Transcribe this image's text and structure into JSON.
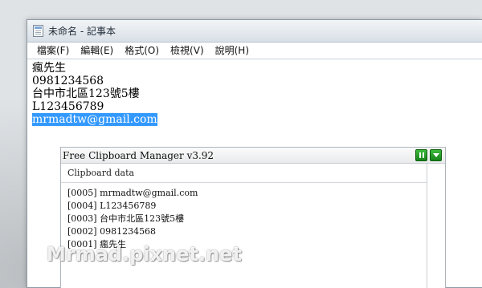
{
  "window": {
    "title": "未命名 - 記事本"
  },
  "menu": {
    "items": [
      {
        "label": "檔案(F)"
      },
      {
        "label": "編輯(E)"
      },
      {
        "label": "格式(O)"
      },
      {
        "label": "檢視(V)"
      },
      {
        "label": "說明(H)"
      }
    ]
  },
  "editor": {
    "lines": [
      "瘋先生",
      "0981234568",
      "台中市北區123號5樓",
      "L123456789",
      "mrmadtw@gmail.com"
    ],
    "selected_line_index": 4
  },
  "clipboard_manager": {
    "title": "Free Clipboard Manager v3.92",
    "header": "Clipboard data",
    "entries": [
      "[0005] mrmadtw@gmail.com",
      "[0004] L123456789",
      "[0003] 台中市北區123號5樓",
      "[0002] 0981234568",
      "[0001] 瘋先生"
    ],
    "pause_icon": "pause-icon",
    "menu_icon": "chevron-down-icon"
  },
  "watermark": "Mrmad.pixnet.net",
  "colors": {
    "selection": "#3399ff",
    "button_green": "#1f9a22"
  }
}
